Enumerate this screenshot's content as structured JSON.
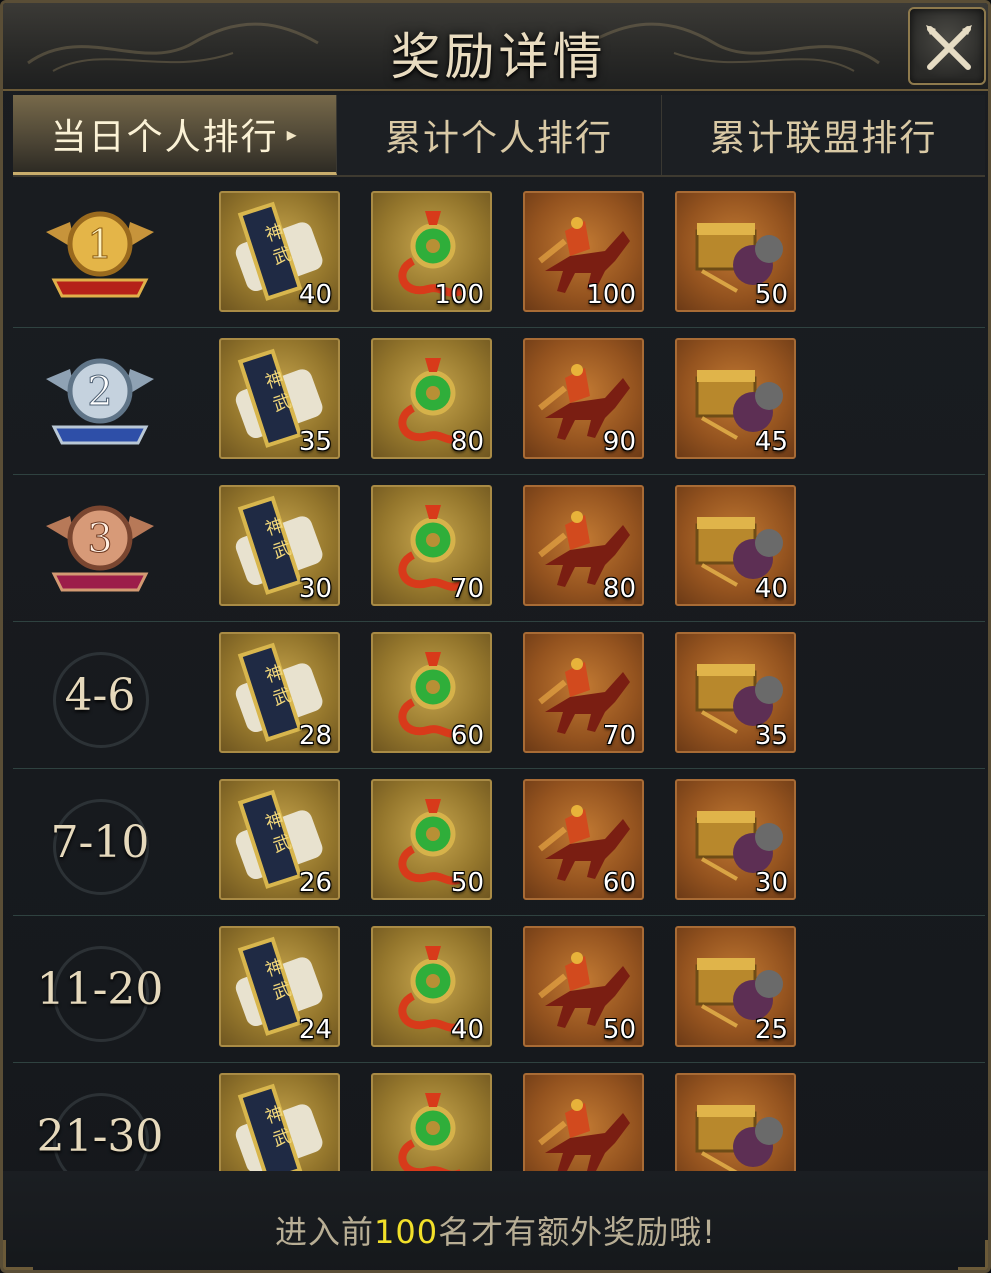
{
  "window": {
    "title": "奖励详情"
  },
  "tabs": [
    {
      "label": "当日个人排行",
      "active": true,
      "caret": "▸"
    },
    {
      "label": "累计个人排行",
      "active": false
    },
    {
      "label": "累计联盟排行",
      "active": false
    }
  ],
  "item_types": [
    {
      "icon": "shenwu-scroll-icon",
      "style": "gold"
    },
    {
      "icon": "jade-pendant-icon",
      "style": "gold"
    },
    {
      "icon": "war-horse-icon",
      "style": "bronze"
    },
    {
      "icon": "treasure-chest-icon",
      "style": "bronze"
    }
  ],
  "ranks": [
    {
      "label": "1",
      "medal": "gold-medal-icon",
      "rewards": [
        "40",
        "100",
        "100",
        "50"
      ]
    },
    {
      "label": "2",
      "medal": "silver-medal-icon",
      "rewards": [
        "35",
        "80",
        "90",
        "45"
      ]
    },
    {
      "label": "3",
      "medal": "bronze-medal-icon",
      "rewards": [
        "30",
        "70",
        "80",
        "40"
      ]
    },
    {
      "label": "4-6",
      "rewards": [
        "28",
        "60",
        "70",
        "35"
      ]
    },
    {
      "label": "7-10",
      "rewards": [
        "26",
        "50",
        "60",
        "30"
      ]
    },
    {
      "label": "11-20",
      "rewards": [
        "24",
        "40",
        "50",
        "25"
      ]
    },
    {
      "label": "21-30",
      "rewards": [
        "",
        "",
        "",
        ""
      ]
    }
  ],
  "footer": {
    "prefix": "进入前",
    "highlight": "100",
    "suffix": "名才有额外奖励哦!"
  },
  "colors": {
    "accent_gold": "#c9ad6c",
    "highlight_yellow": "#f2e02a"
  }
}
